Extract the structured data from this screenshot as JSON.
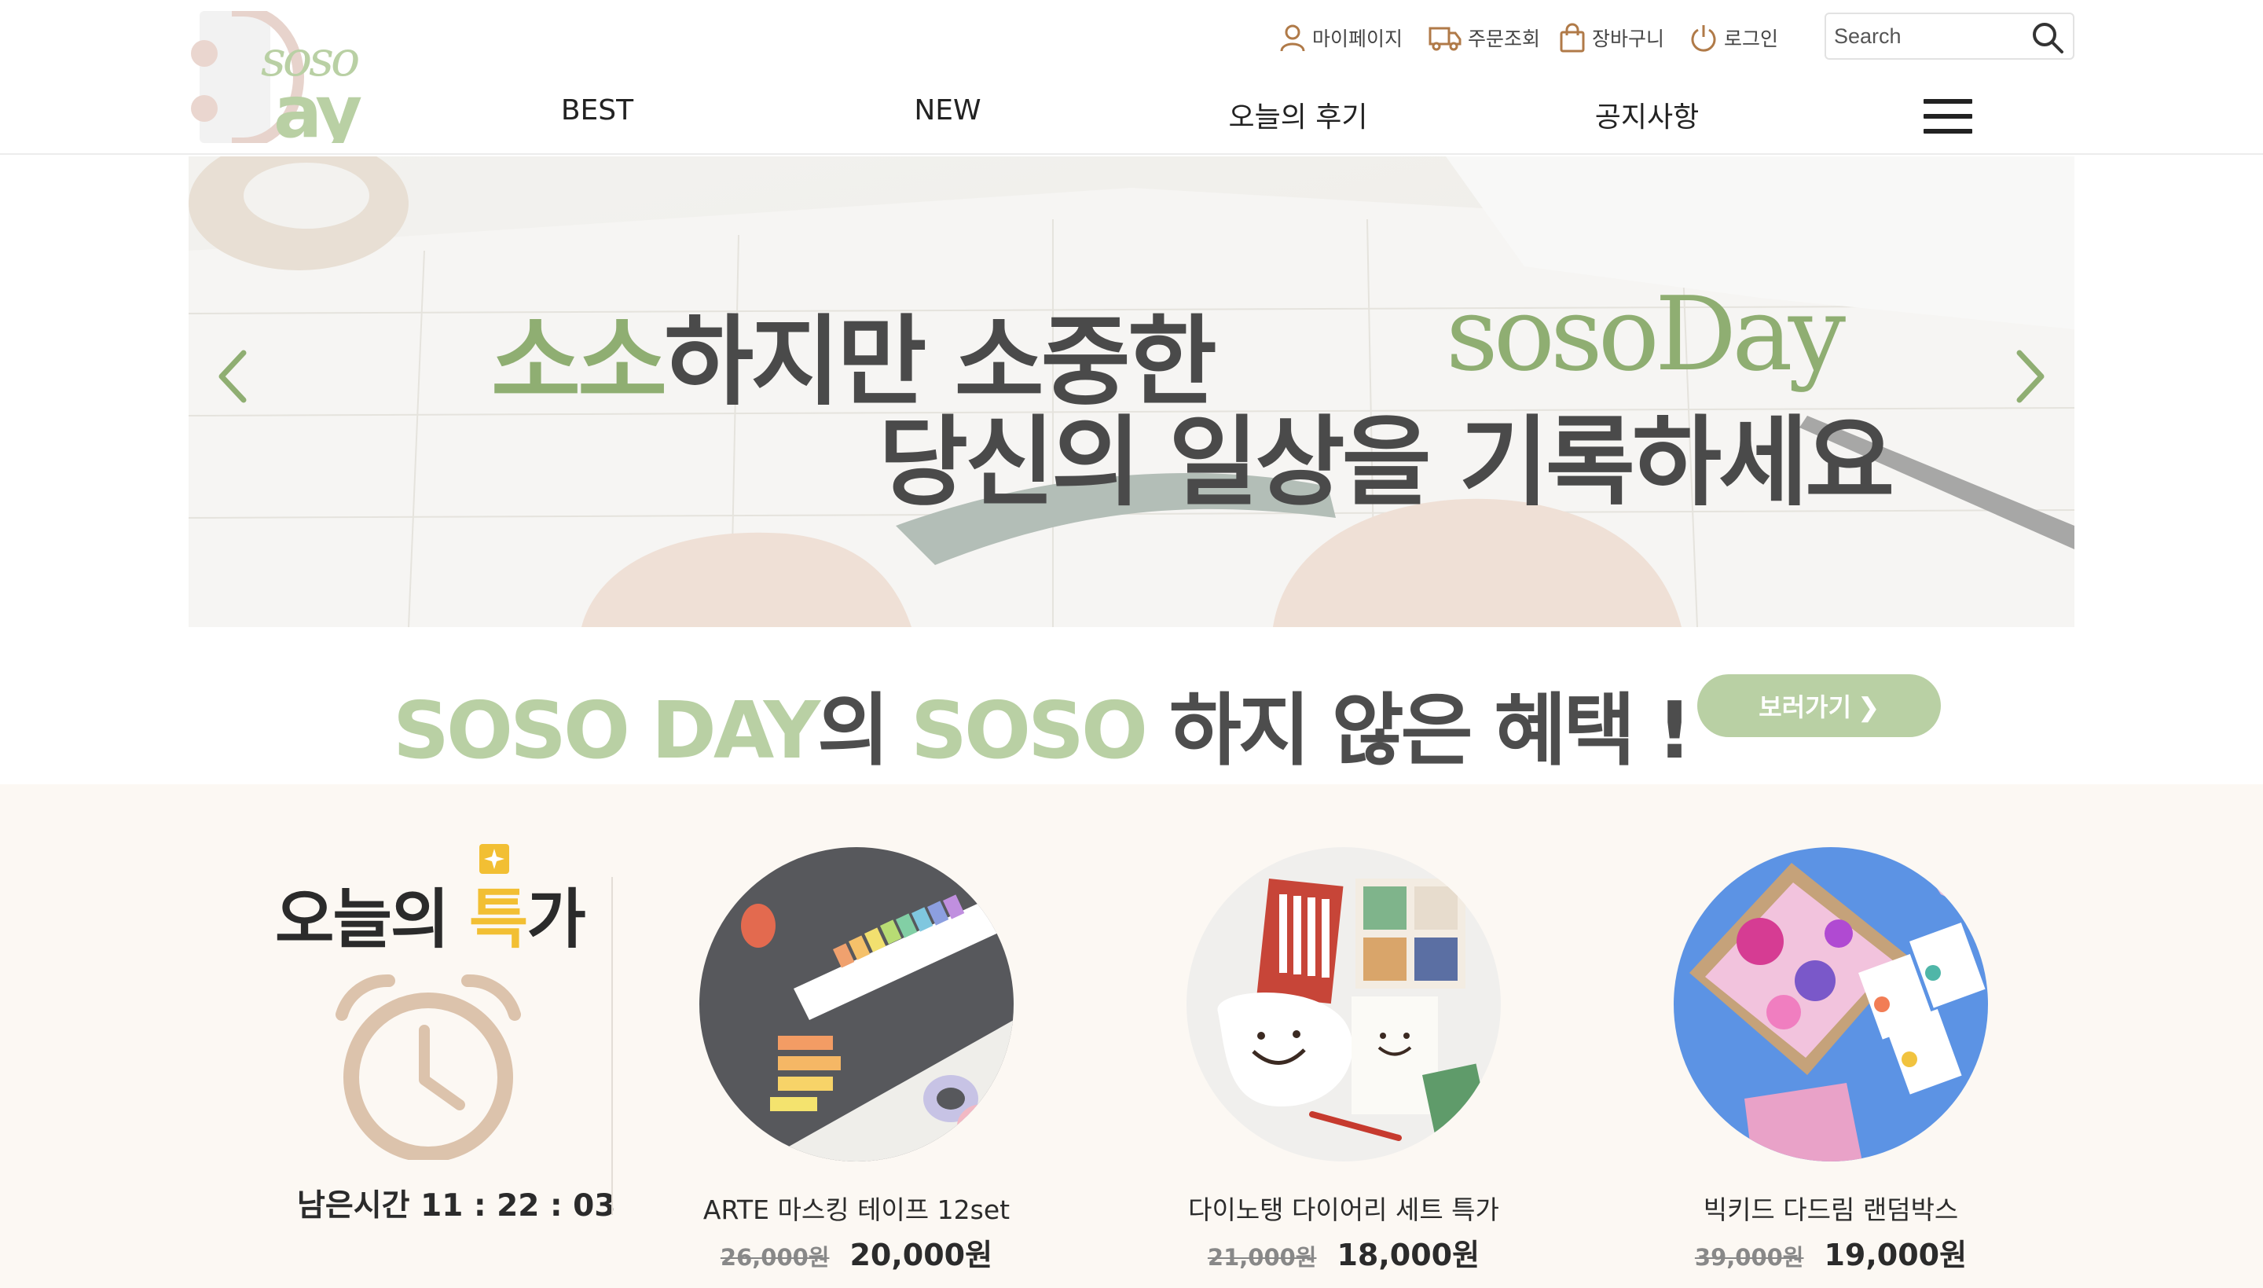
{
  "header": {
    "util_links": [
      {
        "label": "마이페이지",
        "icon": "user-icon"
      },
      {
        "label": "주문조회",
        "icon": "truck-icon"
      },
      {
        "label": "장바구니",
        "icon": "shopping-bag-icon"
      },
      {
        "label": "로그인",
        "icon": "power-icon"
      }
    ],
    "search_placeholder": "Search",
    "nav": [
      {
        "label": "BEST"
      },
      {
        "label": "NEW"
      },
      {
        "label": "오늘의 후기"
      },
      {
        "label": "공지사항"
      }
    ]
  },
  "hero": {
    "line1_accent": "소소",
    "line1_rest": "하지만 소중한",
    "line2": "당신의 일상을 기록하세요",
    "brand": "sosoDay"
  },
  "promo": {
    "part1": "SOSO DAY",
    "part2": "의 ",
    "part3": "SOSO",
    "part4": " 하지 않은 혜택 !",
    "button_label": "보러가기 ❯"
  },
  "deal": {
    "title_prefix": "오늘의 ",
    "title_highlight": "특",
    "title_suffix": "가",
    "timer_label": "남은시간",
    "timer_value": "11 : 22 : 03",
    "products": [
      {
        "name": "ARTE 마스킹 테이프 12set",
        "old_price": "26,000원",
        "price": "20,000원"
      },
      {
        "name": "다이노탱 다이어리 세트 특가",
        "old_price": "21,000원",
        "price": "18,000원"
      },
      {
        "name": "빅키드 다드림 랜덤박스",
        "old_price": "39,000원",
        "price": "19,000원"
      }
    ]
  },
  "colors": {
    "brand_green": "#8fae72",
    "button_green": "#b9d0a4",
    "deal_bg": "#fcf8f3",
    "highlight_yellow": "#f2bf33",
    "clock_tan": "#dcc3ac"
  }
}
